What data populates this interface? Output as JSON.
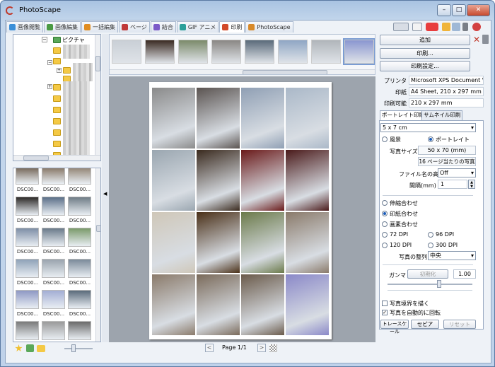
{
  "window": {
    "title": "PhotoScape"
  },
  "tabs": [
    {
      "label": "画像閲覧",
      "color": "#3b8fd8"
    },
    {
      "label": "画像編集",
      "color": "#4a9a43"
    },
    {
      "label": "一括編集",
      "color": "#e08d22"
    },
    {
      "label": "ページ",
      "color": "#c03939"
    },
    {
      "label": "結合",
      "color": "#7b5ac8"
    },
    {
      "label": "GIF アニメ",
      "color": "#2b9f9a"
    },
    {
      "label": "印刷",
      "color": "#d24a2a"
    },
    {
      "label": "PhotoScape",
      "color": "#d88a2a"
    }
  ],
  "tree": {
    "root_label": "ピクチャ"
  },
  "file_thumbs": [
    {
      "label": "DSC00..."
    },
    {
      "label": "DSC00..."
    },
    {
      "label": "DSC00..."
    },
    {
      "label": "DSC00..."
    },
    {
      "label": "DSC00..."
    },
    {
      "label": "DSC00..."
    },
    {
      "label": "DSC00..."
    },
    {
      "label": "DSC00..."
    },
    {
      "label": "DSC00..."
    },
    {
      "label": "DSC00..."
    },
    {
      "label": "DSC00..."
    },
    {
      "label": "DSC00..."
    },
    {
      "label": "DSC00..."
    },
    {
      "label": "DSC00..."
    },
    {
      "label": "DSC00..."
    },
    {
      "label": "DSC00..."
    },
    {
      "label": "DSC00..."
    },
    {
      "label": "DSC00..."
    }
  ],
  "pager": {
    "text": "Page 1/1"
  },
  "right": {
    "add_label": "追加",
    "print_label": "印刷...",
    "print_settings_label": "印刷設定...",
    "printer_label": "プリンタ",
    "printer_value": "Microsoft XPS Document Wr",
    "paper_label": "印紙",
    "paper_value": "A4 Sheet, 210 x 297 mm",
    "printable_label": "印刷可能",
    "printable_value": "210 x 297 mm",
    "tab_portrait": "ポートレイト印刷",
    "tab_thumbnail": "サムネイル印刷",
    "size_select": "5 x 7 cm",
    "landscape": "風景",
    "portrait": "ポートレイト",
    "photo_size_label": "写真サイズ",
    "photo_size_value": "50 x 70 (mm)",
    "per_page": "16 ページ当たりの写真",
    "filename_height_label": "ファイル名の高さ",
    "filename_height_value": "Off",
    "spacing_label": "間隔(mm)",
    "spacing_value": "1",
    "fit_stretch": "伸縮合わせ",
    "fit_paper": "印紙合わせ",
    "fit_pixels": "画素合わせ",
    "dpi72": "72 DPI",
    "dpi96": "96 DPI",
    "dpi120": "120 DPI",
    "dpi300": "300 DPI",
    "align_label": "写真の整列",
    "align_value": "中央",
    "gamma_label": "ガンマ",
    "gamma_reset": "初期化",
    "gamma_value": "1.00",
    "draw_border": "写真境界を描く",
    "auto_rotate": "写真を自動的に回転",
    "trace_button": "トレースケール",
    "sepia_button": "セピア",
    "reset_button": "リセット"
  }
}
